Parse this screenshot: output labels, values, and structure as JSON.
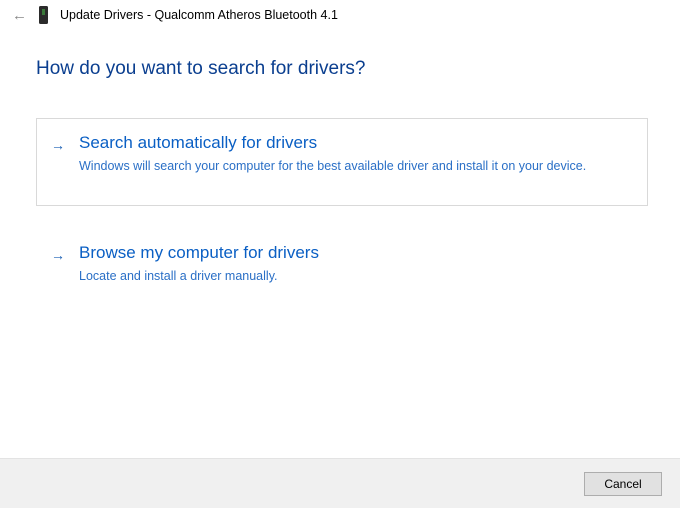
{
  "titlebar": {
    "title": "Update Drivers - Qualcomm Atheros Bluetooth 4.1"
  },
  "heading": "How do you want to search for drivers?",
  "options": [
    {
      "title": "Search automatically for drivers",
      "description": "Windows will search your computer for the best available driver and install it on your device."
    },
    {
      "title": "Browse my computer for drivers",
      "description": "Locate and install a driver manually."
    }
  ],
  "footer": {
    "cancel": "Cancel"
  }
}
